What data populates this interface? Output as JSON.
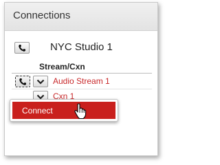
{
  "panel": {
    "title": "Connections"
  },
  "studio": {
    "name": "NYC Studio 1"
  },
  "table": {
    "column_header": "Stream/Cxn",
    "rows": [
      {
        "label": "Audio Stream 1"
      },
      {
        "label": "Cxn 1"
      }
    ]
  },
  "context_menu": {
    "items": [
      {
        "label": "Connect"
      }
    ]
  },
  "colors": {
    "stream_text": "#c8282a",
    "menu_highlight": "#c9201d"
  },
  "icons": {
    "call": "phone-icon",
    "expand": "chevron-down-icon",
    "pointer": "hand-pointer-icon"
  }
}
